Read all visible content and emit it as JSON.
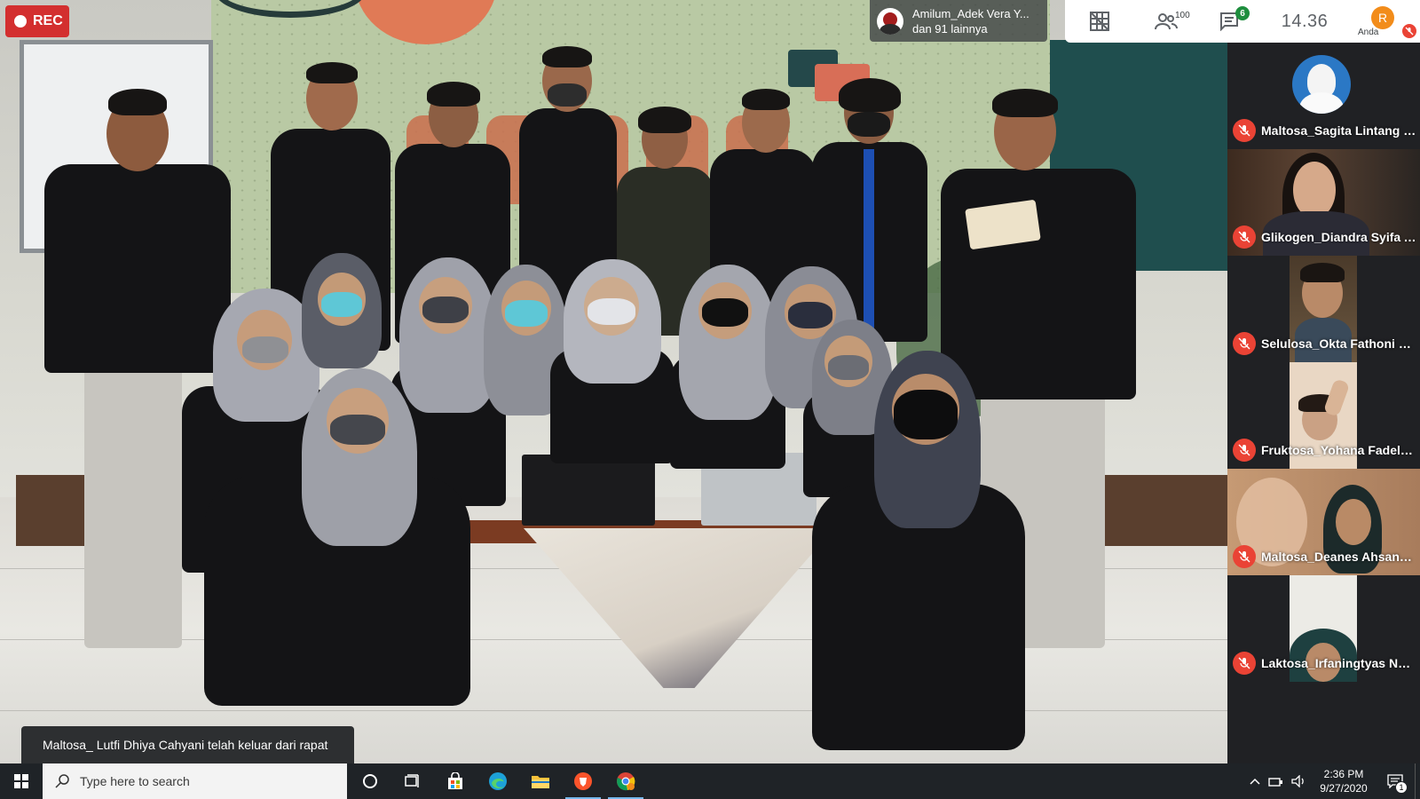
{
  "meeting": {
    "rec_label": "REC",
    "active_speaker": {
      "line1": "Amilum_Adek Vera Y...",
      "line2": "dan 91 lainnya"
    },
    "toolbar": {
      "participant_count": "100",
      "chat_badge": "6",
      "time": "14.36",
      "self_initial": "R",
      "self_label": "Anda"
    },
    "participants": [
      {
        "name": "Maltosa_Sagita Lintang C..."
      },
      {
        "name": "Glikogen_Diandra Syifa Au..."
      },
      {
        "name": "Selulosa_Okta Fathoni Kur..."
      },
      {
        "name": "Fruktosa_Yohana Fadela K..."
      },
      {
        "name": "Maltosa_Deanes Ahsana ..."
      },
      {
        "name": "Laktosa_Irfaningtyas Nur ..."
      }
    ],
    "toast": "Maltosa_ Lutfi Dhiya Cahyani telah keluar dari rapat"
  },
  "taskbar": {
    "search_placeholder": "Type here to search",
    "clock_time": "2:36 PM",
    "clock_date": "9/27/2020",
    "notification_count": "1"
  },
  "colors": {
    "rec_red": "#d32f2f",
    "mute_red": "#ea4335",
    "chat_green": "#1e8e3e",
    "self_orange": "#f28c1a",
    "taskbar_bg": "#1f2327"
  }
}
